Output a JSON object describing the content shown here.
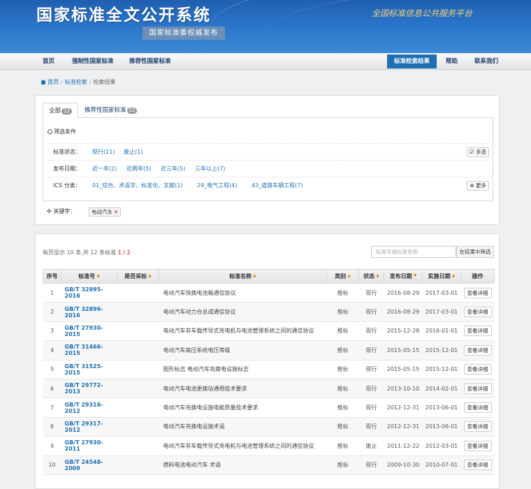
{
  "header": {
    "title": "国家标准全文公开系统",
    "subtitle": "国家标准委权威发布",
    "slogan": "全国标准信息公共服务平台"
  },
  "nav": {
    "items": [
      {
        "label": "首页"
      },
      {
        "label": "强制性国家标准"
      },
      {
        "label": "推荐性国家标准"
      },
      {
        "label": "标准检索结果"
      },
      {
        "label": "帮助"
      },
      {
        "label": "联系我们"
      }
    ]
  },
  "breadcrumb": [
    "首页",
    "标准检索",
    "检索结果"
  ],
  "tabs": [
    {
      "label": "全部",
      "count": "12"
    },
    {
      "label": "推荐性国家标准",
      "count": "12"
    }
  ],
  "filters": {
    "heading": "筛选条件",
    "status": {
      "label": "标准状态：",
      "options": [
        "现行(11)",
        "废止(1)"
      ],
      "button": "多选"
    },
    "date": {
      "label": "发布日期：",
      "options": [
        "近一年(2)",
        "近两年(5)",
        "近三年(5)",
        "三年以上(7)"
      ]
    },
    "ics": {
      "label": "ICS 分类：",
      "options": [
        "01_综合、术语学、标准化、文献(1)",
        "29_电气工程(4)",
        "43_道路车辆工程(7)"
      ],
      "button": "更多"
    }
  },
  "keyword": {
    "label": "关键字：",
    "value": "电动汽车"
  },
  "results": {
    "page_info_prefix": "每页显示 10 条,共 12 条标准",
    "page_current": "1 / 2",
    "search_placeholder": "标准号或标准名称",
    "search_button": "在结果中筛选",
    "columns": [
      "序号",
      "标准号",
      "是否采标",
      "标准名称",
      "类别",
      "状态",
      "发布日期",
      "实施日期",
      "操作"
    ],
    "detail_label": "查看详细",
    "rows": [
      {
        "no": "1",
        "code": "GB/T 32895-2016",
        "adopt": "",
        "name": "电动汽车快换电池箱通信协议",
        "type": "推标",
        "status": "现行",
        "pub": "2016-08-29",
        "impl": "2017-03-01"
      },
      {
        "no": "2",
        "code": "GB/T 32896-2016",
        "adopt": "",
        "name": "电动汽车动力仓总成通信协议",
        "type": "推标",
        "status": "现行",
        "pub": "2016-08-29",
        "impl": "2017-03-01"
      },
      {
        "no": "3",
        "code": "GB/T 27930-2015",
        "adopt": "",
        "name": "电动汽车非车载传导式充电机与电池管理系统之间的通信协议",
        "type": "推标",
        "status": "现行",
        "pub": "2015-12-28",
        "impl": "2016-01-01"
      },
      {
        "no": "4",
        "code": "GB/T 31466-2015",
        "adopt": "",
        "name": "电动汽车高压系统电压等级",
        "type": "推标",
        "status": "现行",
        "pub": "2015-05-15",
        "impl": "2015-12-01"
      },
      {
        "no": "5",
        "code": "GB/T 31525-2015",
        "adopt": "",
        "name": "图形标志 电动汽车充换电设施标志",
        "type": "推标",
        "status": "现行",
        "pub": "2015-05-15",
        "impl": "2015-12-01"
      },
      {
        "no": "6",
        "code": "GB/T 29772-2013",
        "adopt": "",
        "name": "电动汽车电池更换站通用技术要求",
        "type": "推标",
        "status": "现行",
        "pub": "2013-10-10",
        "impl": "2014-02-01"
      },
      {
        "no": "7",
        "code": "GB/T 29316-2012",
        "adopt": "",
        "name": "电动汽车充换电设施电能质量技术要求",
        "type": "推标",
        "status": "现行",
        "pub": "2012-12-31",
        "impl": "2013-06-01"
      },
      {
        "no": "8",
        "code": "GB/T 29317-2012",
        "adopt": "",
        "name": "电动汽车充换电设施术语",
        "type": "推标",
        "status": "现行",
        "pub": "2012-12-31",
        "impl": "2013-06-01"
      },
      {
        "no": "9",
        "code": "GB/T 27930-2011",
        "adopt": "",
        "name": "电动汽车非车载传导式充电机与电池管理系统之间的通信协议",
        "type": "推标",
        "status": "废止",
        "pub": "2011-12-22",
        "impl": "2012-03-01"
      },
      {
        "no": "10",
        "code": "GB/T 24548-2009",
        "adopt": "",
        "name": "燃料电池电动汽车 术语",
        "type": "推标",
        "status": "现行",
        "pub": "2009-10-30",
        "impl": "2010-07-01"
      }
    ]
  }
}
